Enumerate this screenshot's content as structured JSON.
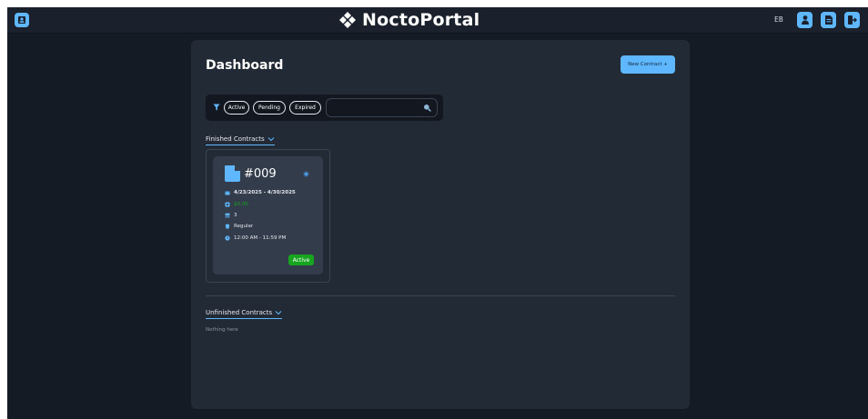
{
  "header": {
    "app_name": "NoctoPortal",
    "language": "EB",
    "accent_color": "#5fb8ff",
    "icons": [
      "portal-home-icon",
      "logo-icon",
      "user-icon",
      "document-icon",
      "logout-icon"
    ]
  },
  "dashboard": {
    "title": "Dashboard",
    "new_contract_label": "New Contract +"
  },
  "filters": {
    "icon": "filter-icon",
    "pills": [
      "Active",
      "Pending",
      "Expired"
    ],
    "search_value": "",
    "search_icon": "search-icon"
  },
  "finished_section": {
    "label": "Finished Contracts",
    "contracts": [
      {
        "id": "#009",
        "date_range": "4/23/2025 - 4/30/2025",
        "amount": "$0.00",
        "amount_color": "#17a520",
        "seats": "3",
        "type": "Regular",
        "time_range": "12:00 AM - 11:59 PM",
        "status": "Active",
        "status_color": "#17a520"
      }
    ]
  },
  "unfinished_section": {
    "label": "Unfinished Contracts",
    "empty_text": "Nothing here"
  }
}
